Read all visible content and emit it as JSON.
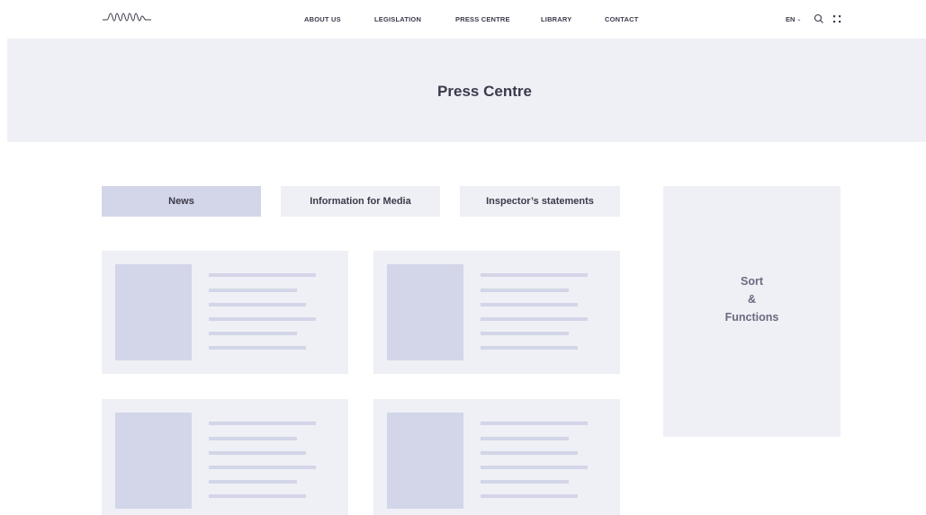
{
  "header": {
    "nav": [
      {
        "label": "ABOUT US"
      },
      {
        "label": "LEGISLATION"
      },
      {
        "label": "PRESS CENTRE"
      },
      {
        "label": "LIBRARY"
      },
      {
        "label": "CONTACT"
      }
    ],
    "language": "EN",
    "icons": [
      "logo",
      "chevron-down-icon",
      "search-icon",
      "grid-menu-icon"
    ]
  },
  "hero": {
    "title": "Press Centre"
  },
  "tabs": [
    {
      "label": "News",
      "active": true
    },
    {
      "label": "Information for Media",
      "active": false
    },
    {
      "label": "Inspector’s statements",
      "active": false
    }
  ],
  "sidebar": {
    "lines": [
      "Sort",
      "&",
      "Functions"
    ]
  },
  "colors": {
    "accent": "#d3d5e8",
    "panel": "#eff0f6",
    "text": "#3b3a4a",
    "muted": "#6b6a80"
  }
}
